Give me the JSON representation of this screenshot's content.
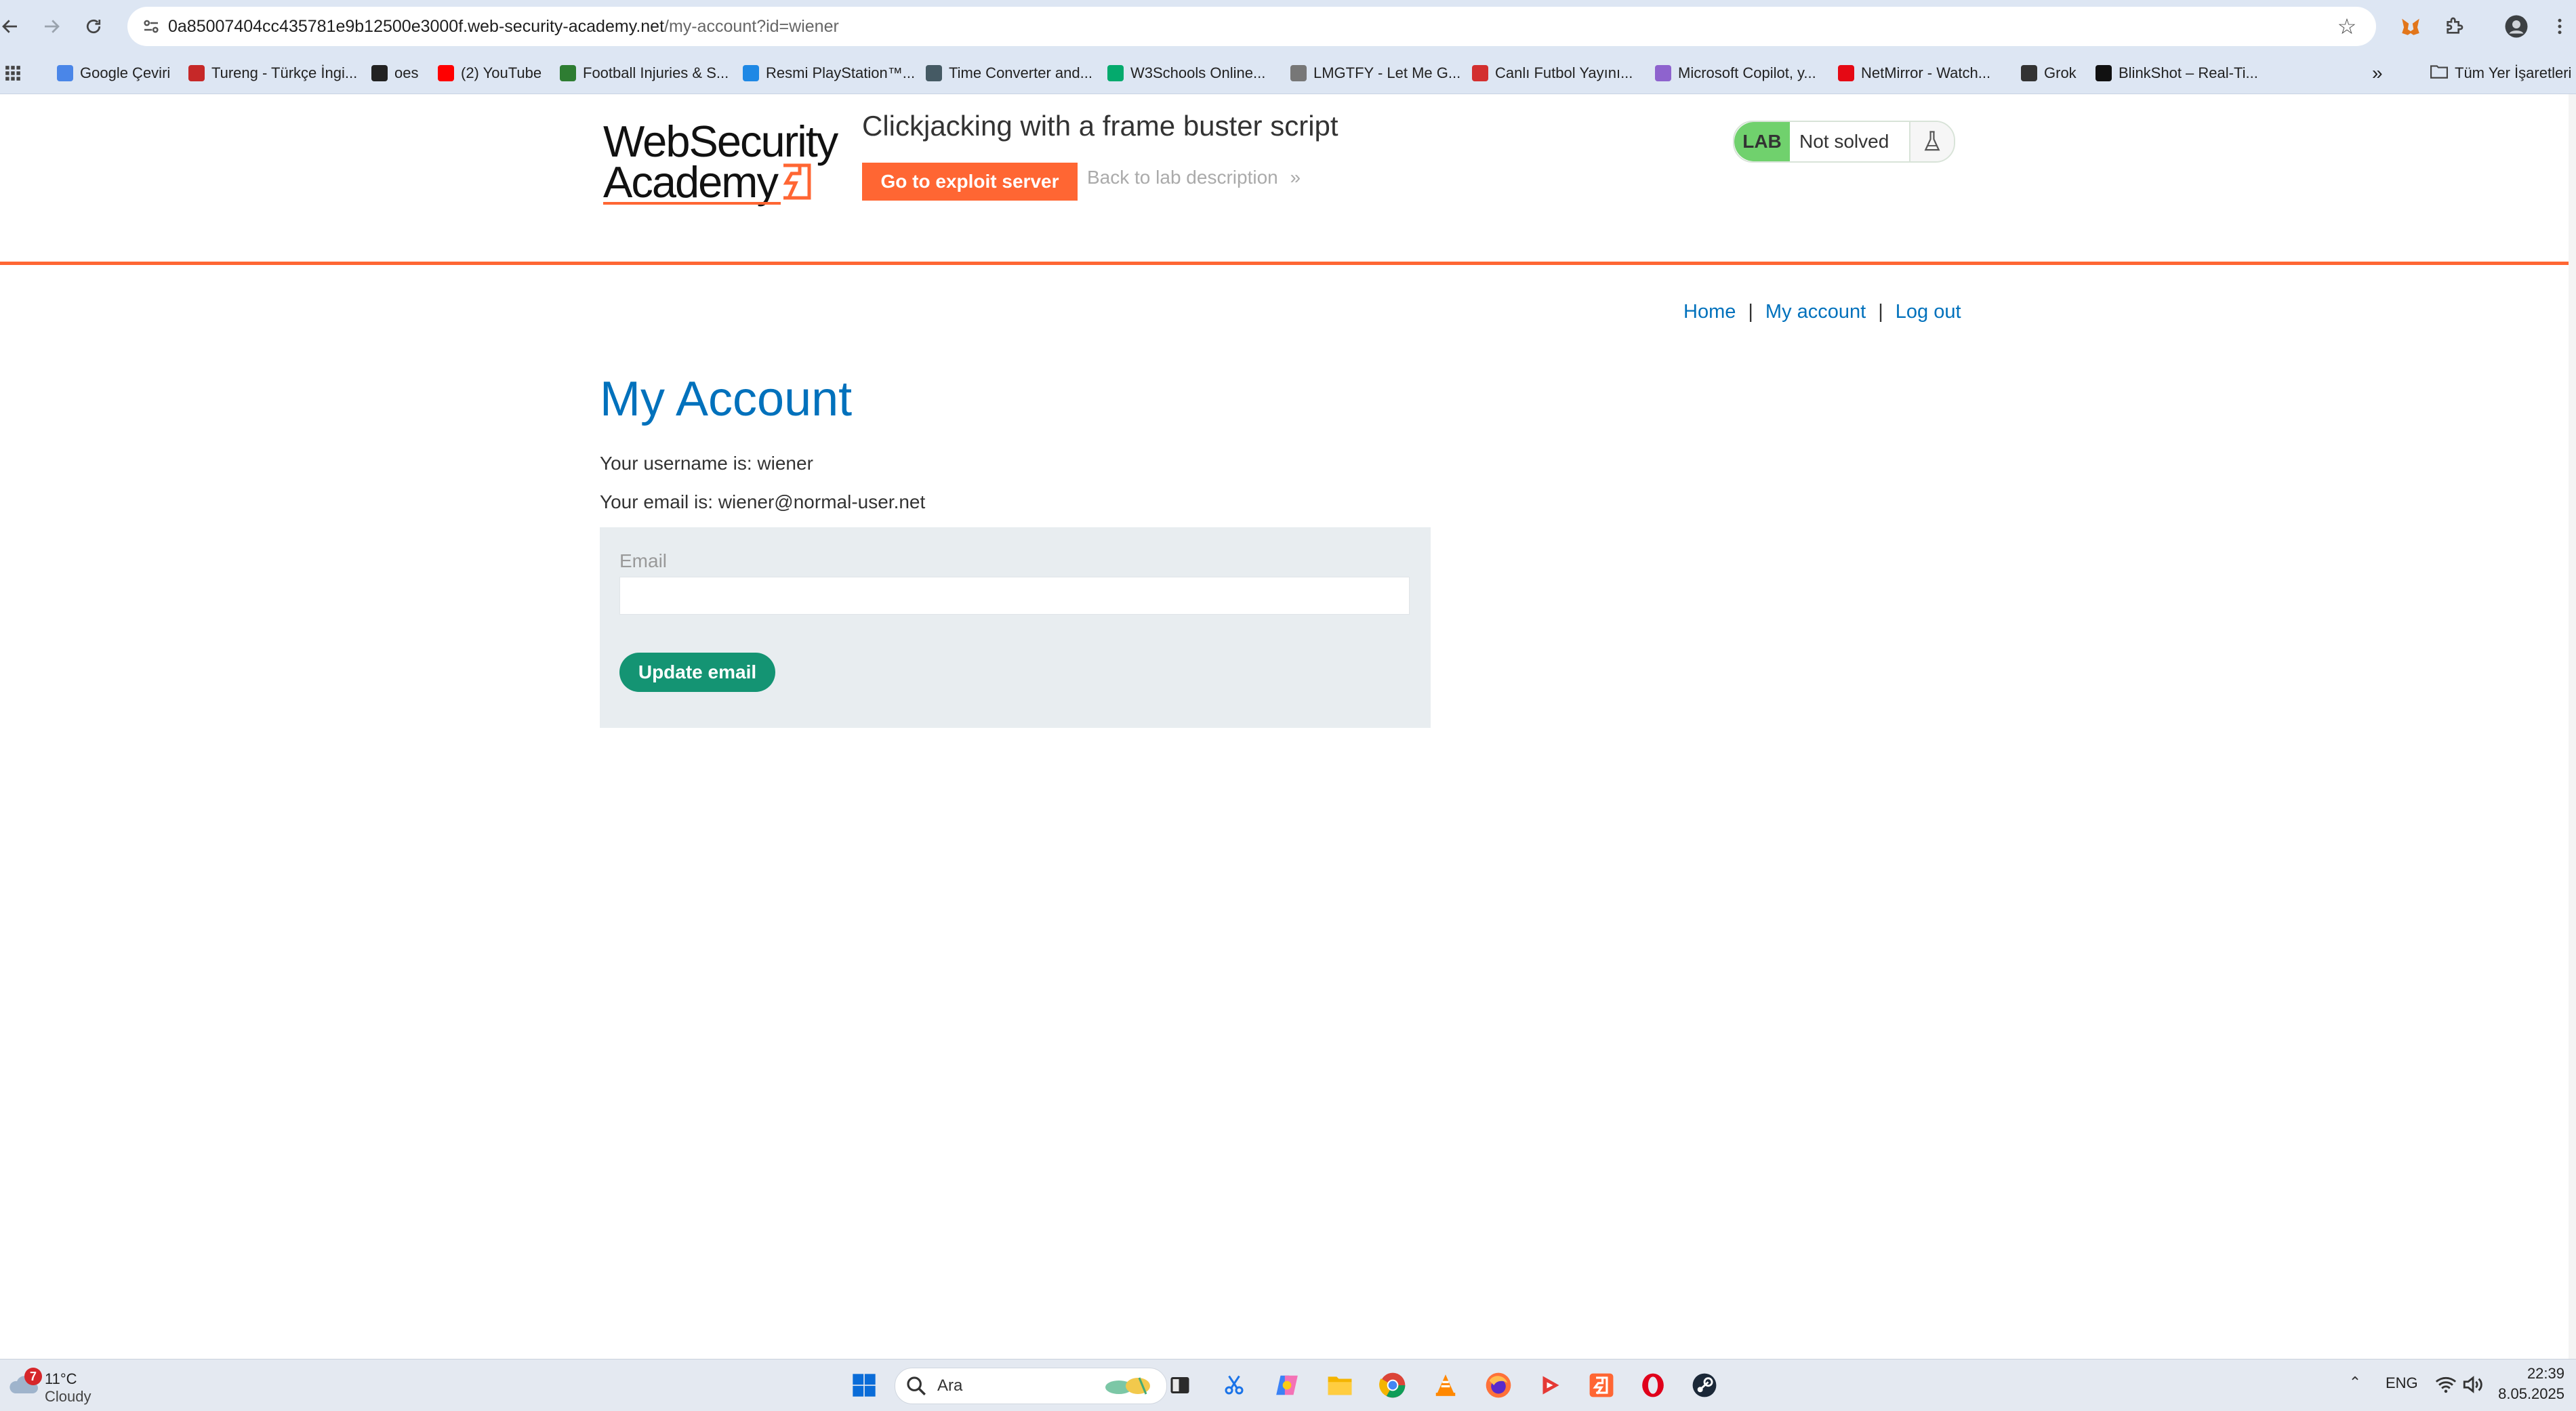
{
  "browser": {
    "url_host": "0a85007404cc435781e9b12500e3000f.web-security-academy.net",
    "url_path": "/my-account?id=wiener",
    "bookmarks": [
      {
        "label": "Google Çeviri",
        "color": "#4a86e8"
      },
      {
        "label": "Tureng - Türkçe İngi...",
        "color": "#c62828"
      },
      {
        "label": "oes",
        "color": "#222222"
      },
      {
        "label": "(2) YouTube",
        "color": "#ff0000"
      },
      {
        "label": "Football Injuries & S...",
        "color": "#2e7d32"
      },
      {
        "label": "Resmi PlayStation™...",
        "color": "#1e88e5"
      },
      {
        "label": "Time Converter and...",
        "color": "#455a64"
      },
      {
        "label": "W3Schools Online...",
        "color": "#04aa6d"
      },
      {
        "label": "LMGTFY - Let Me G...",
        "color": "#777777"
      },
      {
        "label": "Canlı Futbol Yayını...",
        "color": "#d32f2f"
      },
      {
        "label": "Microsoft Copilot, y...",
        "color": "#8e63ce"
      },
      {
        "label": "NetMirror - Watch...",
        "color": "#e50914"
      },
      {
        "label": "Grok",
        "color": "#333333"
      },
      {
        "label": "BlinkShot – Real-Ti...",
        "color": "#111111"
      }
    ],
    "bookmarks_overflow": "»",
    "all_bookmarks": "Tüm Yer İşaretleri"
  },
  "header": {
    "logo_line1": "WebSecurity",
    "logo_line2": "Academy",
    "lab_title": "Clickjacking with a frame buster script",
    "exploit_button": "Go to exploit server",
    "back_link": "Back to lab description",
    "back_arrow": "»",
    "lab_badge": "LAB",
    "lab_status": "Not solved"
  },
  "nav": {
    "home": "Home",
    "separator": "|",
    "my_account": "My account",
    "log_out": "Log out"
  },
  "main": {
    "heading": "My Account",
    "username_line": "Your username is: wiener",
    "email_line": "Your email is: wiener@normal-user.net",
    "email_label": "Email",
    "email_value": "",
    "update_button": "Update email"
  },
  "taskbar": {
    "weather_badge": "7",
    "weather_temp": "11°C",
    "weather_condition": "Cloudy",
    "search_placeholder": "Ara",
    "lang": "ENG",
    "time": "22:39",
    "date": "8.05.2025"
  },
  "colors": {
    "accent_orange": "#ff6633",
    "link_blue": "#0071bc",
    "button_green": "#149473",
    "lab_green": "#70d16d"
  }
}
